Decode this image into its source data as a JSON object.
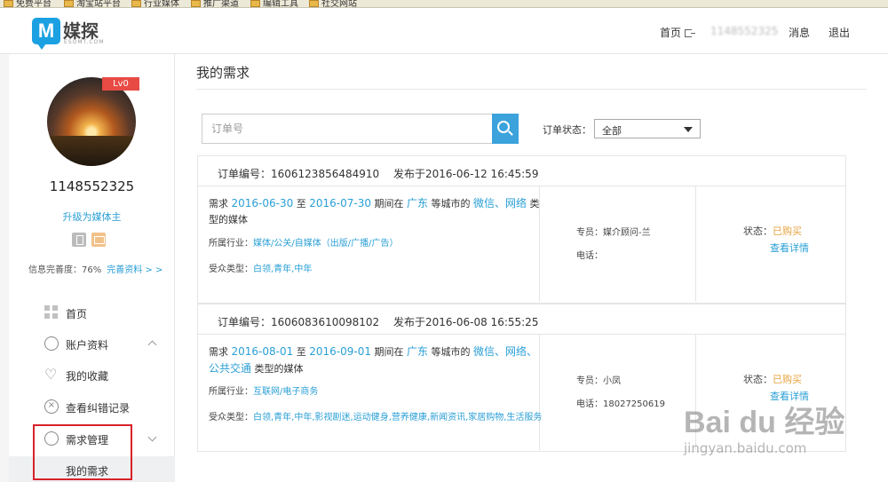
{
  "bookmarks": [
    {
      "label": "免费平台"
    },
    {
      "label": "淘宝站平台"
    },
    {
      "label": "行业媒体"
    },
    {
      "label": "推广渠道"
    },
    {
      "label": "编辑工具"
    },
    {
      "label": "社交网站"
    }
  ],
  "header": {
    "logo_cn": "媒探",
    "logo_en": "ESOMT.COM",
    "nav_home": "首页",
    "nav_user": "1148552325",
    "nav_messages": "消息",
    "nav_logout": "退出"
  },
  "sidebar": {
    "level_badge": "Lv0",
    "user_id": "1148552325",
    "upgrade": "升级为媒体主",
    "completeness_label": "信息完善度：76%",
    "complete_link": "完善资料 > >",
    "menu": [
      {
        "label": "首页"
      },
      {
        "label": "账户资料"
      },
      {
        "label": "我的收藏"
      },
      {
        "label": "查看纠错记录"
      },
      {
        "label": "需求管理"
      }
    ],
    "submenu_item": "我的需求"
  },
  "main": {
    "title": "我的需求",
    "search_placeholder": "订单号",
    "status_label": "订单状态：",
    "status_value": "全部"
  },
  "orders": [
    {
      "order_no": "订单编号：1606123856484910",
      "publish_time": "发布于2016-06-12 16:45:59",
      "req_prefix": "需求",
      "start_date": "2016-06-30",
      "to": "至",
      "end_date": "2016-07-30",
      "period_in": "期间在",
      "city": "广东",
      "cities_suffix": "等城市的",
      "channels": "微信、网络",
      "type_suffix": "类型的媒体",
      "industry_label": "所属行业：",
      "industry": "媒体/公关/自媒体（出版/广播/广告）",
      "audience_label": "受众类型：",
      "audience": "白领,青年,中年",
      "agent": "专员：媒介顾问-兰",
      "phone": "电话：",
      "status_label": "状态：",
      "status": "已购买",
      "detail": "查看详情"
    },
    {
      "order_no": "订单编号：1606083610098102",
      "publish_time": "发布于2016-06-08 16:55:25",
      "req_prefix": "需求",
      "start_date": "2016-08-01",
      "to": "至",
      "end_date": "2016-09-01",
      "period_in": "期间在",
      "city": "广东",
      "cities_suffix": "等城市的",
      "channels": "微信、网络、公共交通",
      "type_suffix": "类型的媒体",
      "industry_label": "所属行业：",
      "industry": "互联网/电子商务",
      "audience_label": "受众类型：",
      "audience": "白领,青年,中年,影视剧迷,运动健身,营养健康,新闻资讯,家居购物,生活服务",
      "agent": "专员：小凤",
      "phone": "电话：18027250619",
      "status_label": "状态：",
      "status": "已购买",
      "detail": "查看详情"
    }
  ],
  "watermark": {
    "brand": "Bai du 经验",
    "url": "jingyan.baidu.com"
  }
}
